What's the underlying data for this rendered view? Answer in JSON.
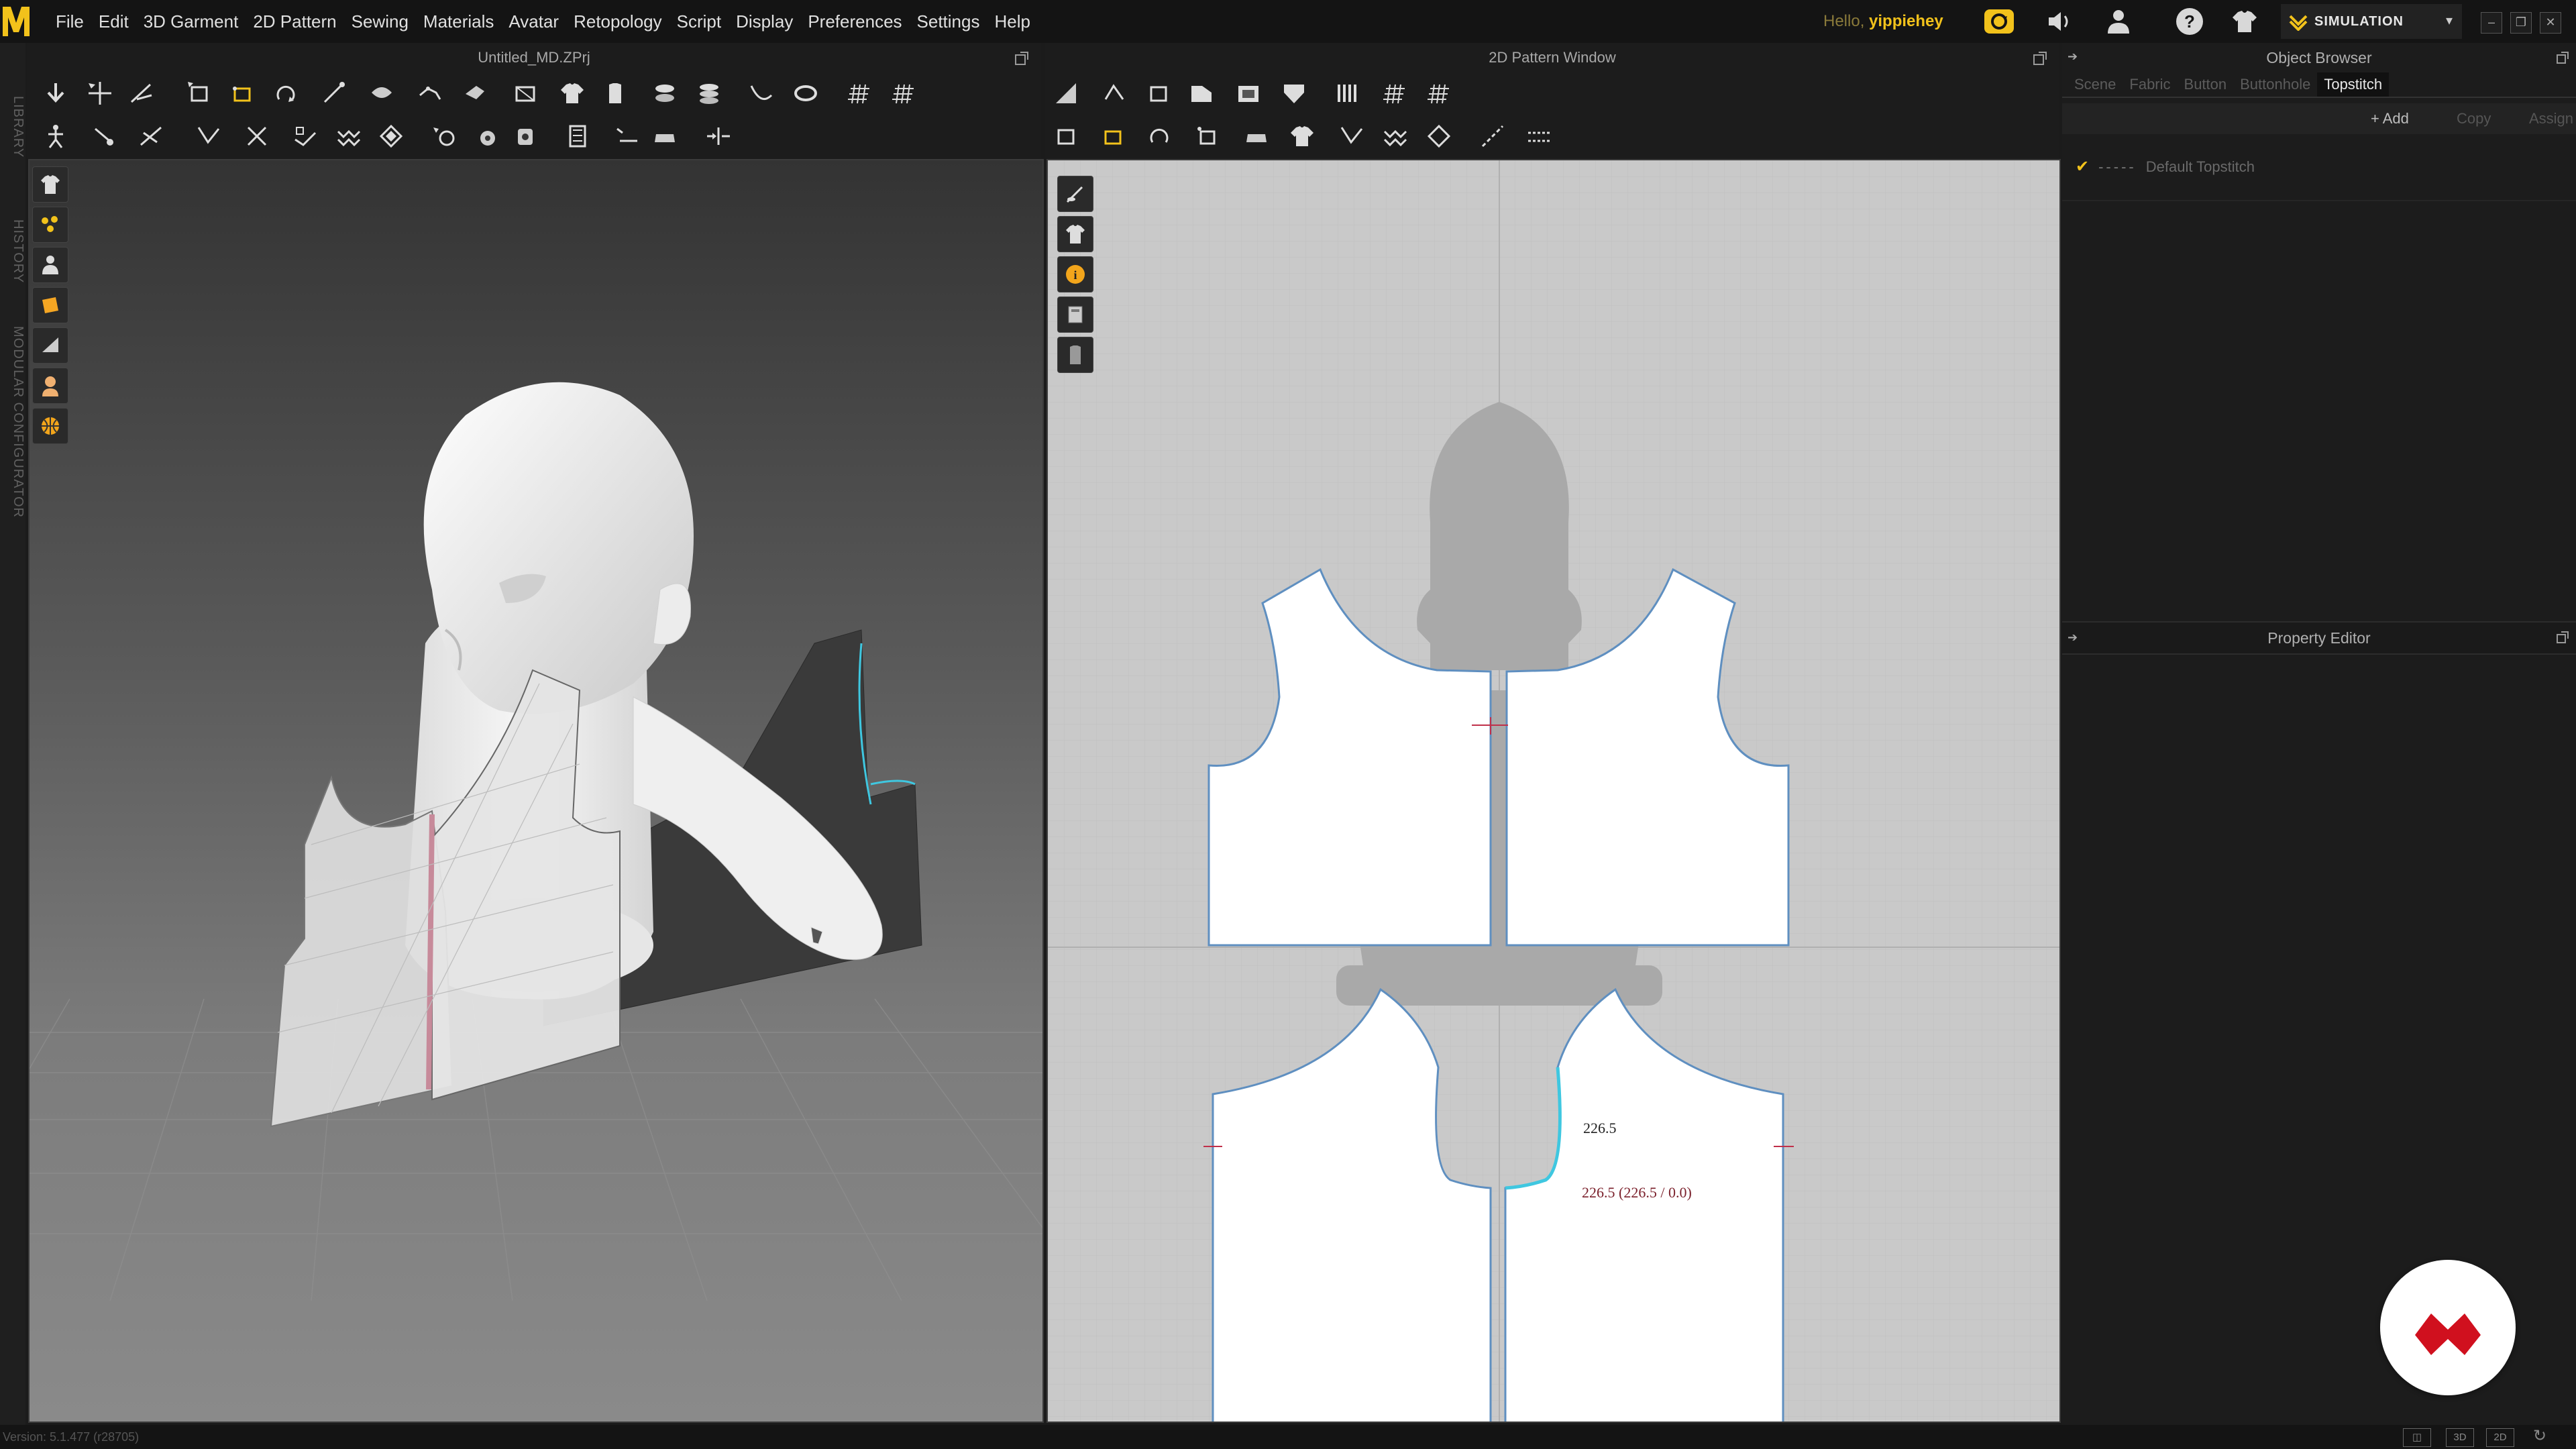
{
  "menu": {
    "items": [
      "File",
      "Edit",
      "3D Garment",
      "2D Pattern",
      "Sewing",
      "Materials",
      "Avatar",
      "Retopology",
      "Script",
      "Display",
      "Preferences",
      "Settings",
      "Help"
    ]
  },
  "user": {
    "greeting": "Hello,",
    "name": "yippiehey"
  },
  "mode": {
    "label": "SIMULATION"
  },
  "window3d": {
    "title": "Untitled_MD.ZPrj"
  },
  "window2d": {
    "title": "2D Pattern Window",
    "measure_label": "226.5",
    "measure_detail": "226.5 (226.5 / 0.0)"
  },
  "side_tabs": [
    "LIBRARY",
    "HISTORY",
    "MODULAR CONFIGURATOR"
  ],
  "object_browser": {
    "title": "Object Browser",
    "tabs": [
      "Scene",
      "Fabric",
      "Button",
      "Buttonhole",
      "Topstitch"
    ],
    "active_tab": "Topstitch",
    "actions": {
      "add": "+ Add",
      "copy": "Copy",
      "assign": "Assign"
    },
    "item": "Default Topstitch"
  },
  "property_editor": {
    "title": "Property Editor"
  },
  "status": {
    "version": "Version: 5.1.477 (r28705)"
  },
  "view_buttons": [
    "",
    "3D",
    "2D"
  ],
  "colors": {
    "accent_yellow": "#f2c21b",
    "seam_highlight": "#3fc7e0",
    "brand_red": "#d0101e"
  }
}
